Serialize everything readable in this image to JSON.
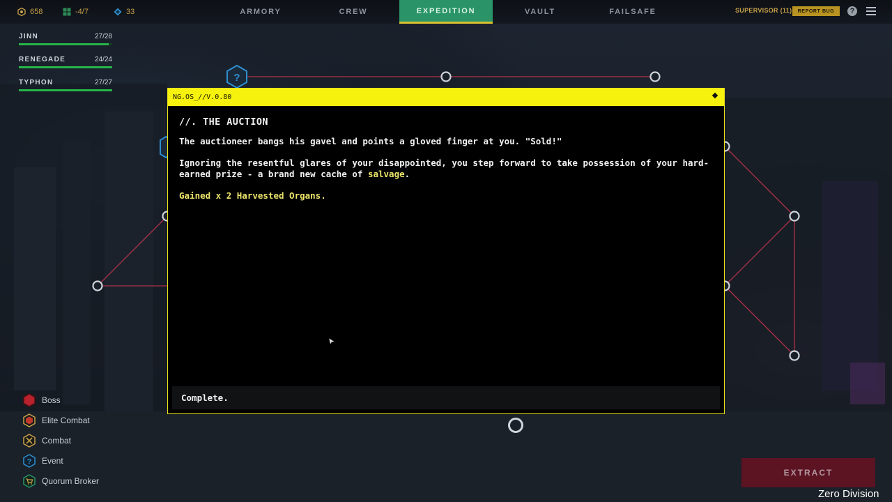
{
  "resources": [
    {
      "icon": "gear-coin-icon",
      "value": "658",
      "color": "#c7a048"
    },
    {
      "icon": "grid-icon",
      "value": "-4/7",
      "color": "#c7a048"
    },
    {
      "icon": "crystal-icon",
      "value": "33",
      "color": "#c7a048"
    }
  ],
  "nav": {
    "tabs": [
      "ARMORY",
      "CREW",
      "EXPEDITION",
      "VAULT",
      "FAILSAFE"
    ],
    "active": "EXPEDITION"
  },
  "header": {
    "supervisor": "SUPERVISOR (11)",
    "report_bug": "REPORT BUG",
    "help": "?"
  },
  "crew": [
    {
      "name": "JINN",
      "hp": "27/28",
      "fill": 0.964
    },
    {
      "name": "RENEGADE",
      "hp": "24/24",
      "fill": 1.0
    },
    {
      "name": "TYPHON",
      "hp": "27/27",
      "fill": 1.0
    }
  ],
  "legend": [
    {
      "label": "Boss",
      "icon": "boss-hex-icon",
      "color": "#b8222c"
    },
    {
      "label": "Elite Combat",
      "icon": "elite-combat-hex-icon",
      "color": "#c0392b"
    },
    {
      "label": "Combat",
      "icon": "crossed-swords-icon",
      "color": "#c7a048"
    },
    {
      "label": "Event",
      "icon": "question-hex-icon",
      "color": "#2f8fcf"
    },
    {
      "label": "Quorum Broker",
      "icon": "cart-icon",
      "color": "#c7a048"
    }
  ],
  "dialog": {
    "title": "NG.OS_//V.0.80",
    "event_title": "//. THE AUCTION",
    "para1": "The auctioneer bangs his gavel and points a gloved finger at you. \"Sold!\"",
    "para2_pre": "Ignoring the resentful glares of your disappointed, you step forward to take possession of your hard-earned prize - a brand new cache of ",
    "para2_highlight": "salvage",
    "para2_post": ".",
    "gain": "Gained x 2 Harvested Organs.",
    "complete": "Complete."
  },
  "extract": "EXTRACT",
  "watermark": "Zero Division",
  "colors": {
    "accent_yellow": "#f7f10e",
    "active_tab": "#2a9468",
    "map_line": "#c8354e",
    "extract_bg": "#5c1322"
  }
}
